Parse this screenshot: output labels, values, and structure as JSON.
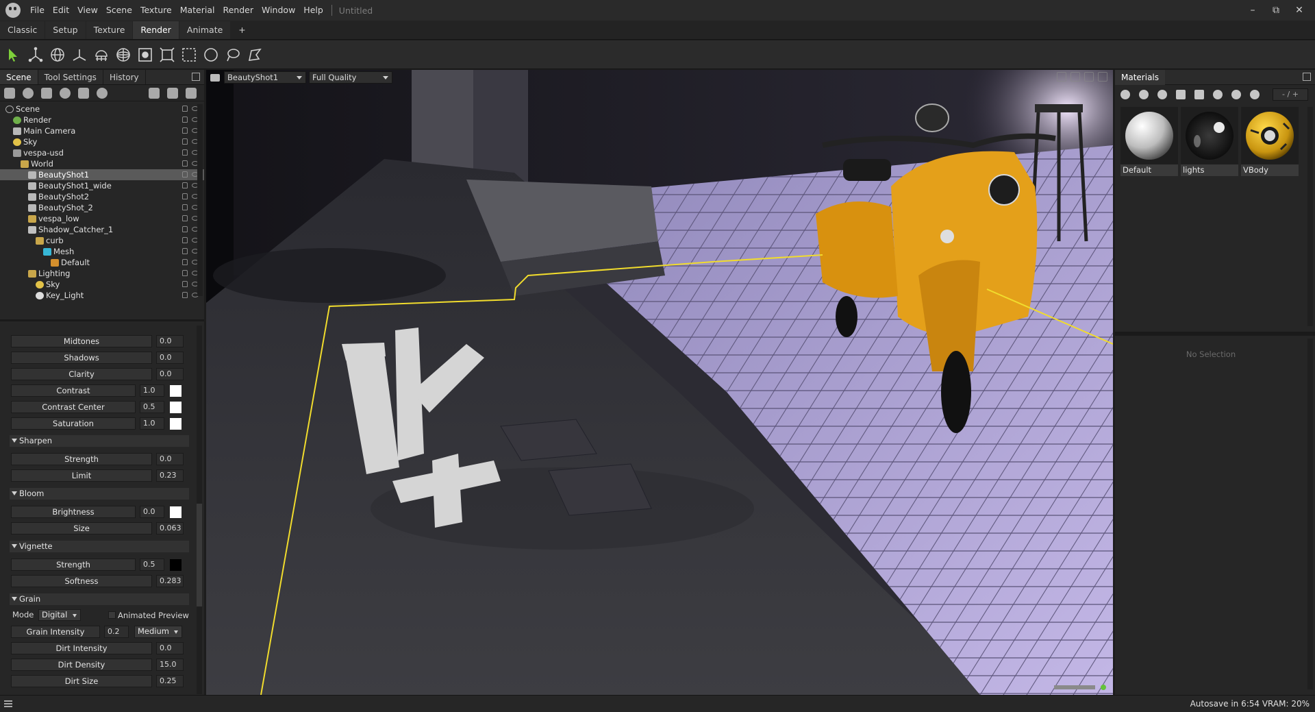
{
  "menubar": {
    "items": [
      "File",
      "Edit",
      "View",
      "Scene",
      "Texture",
      "Material",
      "Render",
      "Window",
      "Help"
    ],
    "doc_title": "Untitled",
    "window_controls": [
      "minimize-icon",
      "restore-icon",
      "close-icon"
    ]
  },
  "workspace_tabs": [
    {
      "label": "Classic",
      "active": false
    },
    {
      "label": "Setup",
      "active": false
    },
    {
      "label": "Texture",
      "active": false
    },
    {
      "label": "Render",
      "active": true
    },
    {
      "label": "Animate",
      "active": false
    },
    {
      "label": "+",
      "active": false
    }
  ],
  "toolbar": {
    "tools": [
      "select-arrow-icon",
      "transform-icon",
      "rotate-globe-icon",
      "axis-icon",
      "lamp-icon",
      "sphere-icon",
      "focus-icon",
      "frame-icon",
      "marquee-icon",
      "circle-icon",
      "lasso-icon",
      "polygon-lasso-icon"
    ],
    "active_color": "#7ed03a"
  },
  "left_panel": {
    "tabs": [
      {
        "label": "Scene",
        "active": true
      },
      {
        "label": "Tool Settings",
        "active": false
      },
      {
        "label": "History",
        "active": false
      }
    ]
  },
  "scene_tree": [
    {
      "label": "Scene",
      "icon": "scene",
      "indent": 0,
      "selected": false
    },
    {
      "label": "Render",
      "icon": "gear",
      "indent": 1,
      "selected": false
    },
    {
      "label": "Main Camera",
      "icon": "cam",
      "indent": 1,
      "selected": false
    },
    {
      "label": "Sky",
      "icon": "sun",
      "indent": 1,
      "selected": false
    },
    {
      "label": "vespa-usd",
      "icon": "usd",
      "indent": 1,
      "selected": false
    },
    {
      "label": "World",
      "icon": "folder",
      "indent": 2,
      "selected": false
    },
    {
      "label": "BeautyShot1",
      "icon": "cam",
      "indent": 3,
      "selected": true
    },
    {
      "label": "BeautyShot1_wide",
      "icon": "cam",
      "indent": 3,
      "selected": false
    },
    {
      "label": "BeautyShot2",
      "icon": "cam",
      "indent": 3,
      "selected": false
    },
    {
      "label": "BeautyShot_2",
      "icon": "cam",
      "indent": 3,
      "selected": false
    },
    {
      "label": "vespa_low",
      "icon": "folder",
      "indent": 3,
      "selected": false
    },
    {
      "label": "Shadow_Catcher_1",
      "icon": "shadow",
      "indent": 3,
      "selected": false
    },
    {
      "label": "curb",
      "icon": "folder",
      "indent": 4,
      "selected": false
    },
    {
      "label": "Mesh",
      "icon": "mesh",
      "indent": 5,
      "selected": false
    },
    {
      "label": "Default",
      "icon": "mat",
      "indent": 6,
      "selected": false
    },
    {
      "label": "Lighting",
      "icon": "folder",
      "indent": 3,
      "selected": false
    },
    {
      "label": "Sky",
      "icon": "sun",
      "indent": 4,
      "selected": false
    },
    {
      "label": "Key_Light",
      "icon": "light",
      "indent": 4,
      "selected": false
    }
  ],
  "properties": {
    "midtones": {
      "label": "Midtones",
      "value": "0.0"
    },
    "shadows": {
      "label": "Shadows",
      "value": "0.0"
    },
    "clarity": {
      "label": "Clarity",
      "value": "0.0"
    },
    "contrast": {
      "label": "Contrast",
      "value": "1.0",
      "color": "#ffffff"
    },
    "contrast_center": {
      "label": "Contrast Center",
      "value": "0.5",
      "color": "#ffffff"
    },
    "saturation": {
      "label": "Saturation",
      "value": "1.0",
      "color": "#ffffff"
    },
    "sharpen": {
      "title": "Sharpen",
      "strength": {
        "label": "Strength",
        "value": "0.0"
      },
      "limit": {
        "label": "Limit",
        "value": "0.23"
      }
    },
    "bloom": {
      "title": "Bloom",
      "brightness": {
        "label": "Brightness",
        "value": "0.0",
        "color": "#ffffff"
      },
      "size": {
        "label": "Size",
        "value": "0.063"
      }
    },
    "vignette": {
      "title": "Vignette",
      "strength": {
        "label": "Strength",
        "value": "0.5",
        "color": "#000000"
      },
      "softness": {
        "label": "Softness",
        "value": "0.283"
      }
    },
    "grain": {
      "title": "Grain",
      "mode_label": "Mode",
      "mode_value": "Digital",
      "animated_preview": "Animated Preview",
      "grain_intensity": {
        "label": "Grain Intensity",
        "value": "0.2",
        "preset": "Medium"
      },
      "dirt_intensity": {
        "label": "Dirt Intensity",
        "value": "0.0"
      },
      "dirt_density": {
        "label": "Dirt Density",
        "value": "15.0"
      },
      "dirt_size": {
        "label": "Dirt Size",
        "value": "0.25"
      }
    }
  },
  "viewport": {
    "camera": "BeautyShot1",
    "quality": "Full Quality"
  },
  "materials_panel": {
    "title": "Materials",
    "count": "- / +",
    "materials": [
      {
        "name": "Default"
      },
      {
        "name": "lights"
      },
      {
        "name": "VBody"
      }
    ],
    "empty_state": "No Selection"
  },
  "statusbar": {
    "text": "Autosave in 6:54   VRAM: 20%"
  }
}
